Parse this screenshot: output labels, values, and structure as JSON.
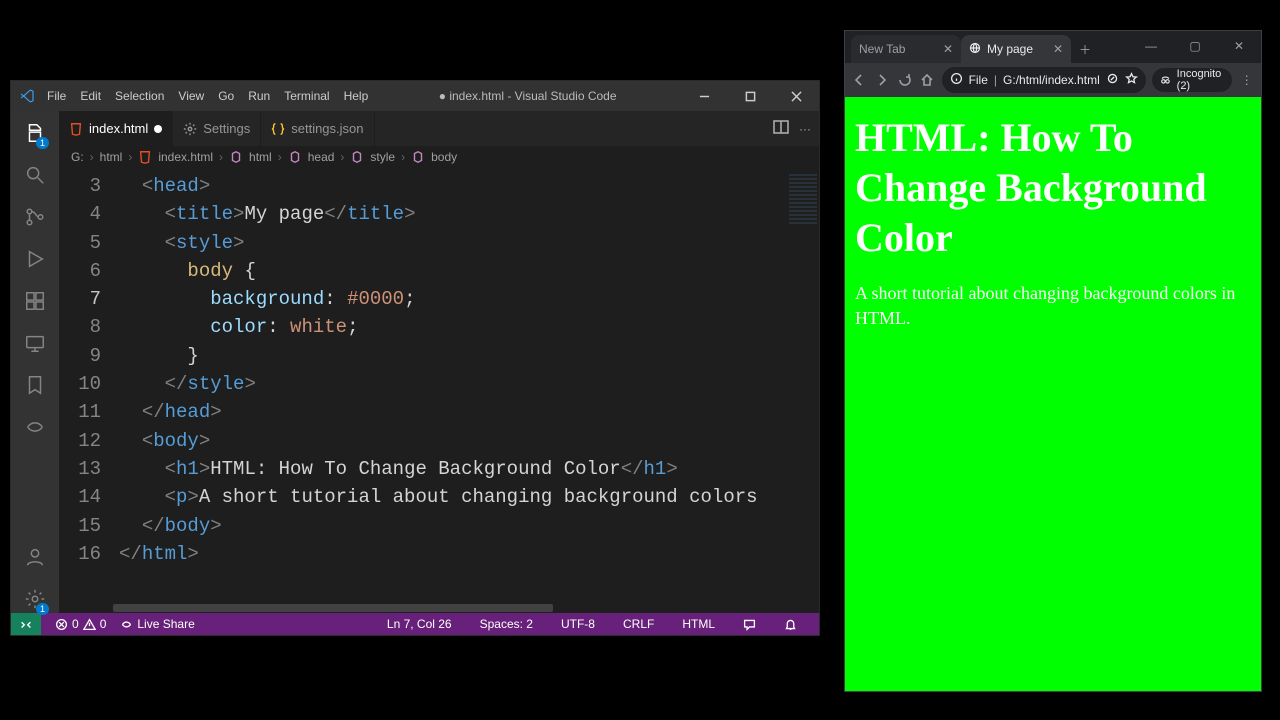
{
  "vscode": {
    "menus": [
      "File",
      "Edit",
      "Selection",
      "View",
      "Go",
      "Run",
      "Terminal",
      "Help"
    ],
    "window_title": "● index.html - Visual Studio Code",
    "tabs": [
      {
        "label": "index.html",
        "dirty": true,
        "active": true,
        "icon": "html"
      },
      {
        "label": "Settings",
        "dirty": false,
        "active": false,
        "icon": "gear"
      },
      {
        "label": "settings.json",
        "dirty": false,
        "active": false,
        "icon": "json"
      }
    ],
    "breadcrumbs": [
      "G:",
      "html",
      "index.html",
      "html",
      "head",
      "style",
      "body"
    ],
    "gutter_start": 3,
    "gutter_end": 16,
    "code_lines": [
      {
        "n": 3,
        "html": "  <span class='tok-tag'>&lt;</span><span class='tok-name'>head</span><span class='tok-tag'>&gt;</span>"
      },
      {
        "n": 4,
        "html": "    <span class='tok-tag'>&lt;</span><span class='tok-name'>title</span><span class='tok-tag'>&gt;</span><span class='tok-text'>My page</span><span class='tok-tag'>&lt;/</span><span class='tok-name'>title</span><span class='tok-tag'>&gt;</span>"
      },
      {
        "n": 5,
        "html": "    <span class='tok-tag'>&lt;</span><span class='tok-name'>style</span><span class='tok-tag'>&gt;</span>"
      },
      {
        "n": 6,
        "html": "      <span class='tok-sel'>body</span> <span class='tok-punc'>{</span>"
      },
      {
        "n": 7,
        "html": "        <span class='tok-prop'>background</span><span class='tok-punc'>:</span> <span class='tok-num'>#0000</span><span class='tok-punc'>;</span>",
        "cursor": true
      },
      {
        "n": 8,
        "html": "        <span class='tok-prop'>color</span><span class='tok-punc'>:</span> <span class='tok-str'>white</span><span class='tok-punc'>;</span>"
      },
      {
        "n": 9,
        "html": "      <span class='tok-punc'>}</span>"
      },
      {
        "n": 10,
        "html": "    <span class='tok-tag'>&lt;/</span><span class='tok-name'>style</span><span class='tok-tag'>&gt;</span>"
      },
      {
        "n": 11,
        "html": "  <span class='tok-tag'>&lt;/</span><span class='tok-name'>head</span><span class='tok-tag'>&gt;</span>"
      },
      {
        "n": 12,
        "html": "  <span class='tok-tag'>&lt;</span><span class='tok-name'>body</span><span class='tok-tag'>&gt;</span>"
      },
      {
        "n": 13,
        "html": "    <span class='tok-tag'>&lt;</span><span class='tok-name'>h1</span><span class='tok-tag'>&gt;</span><span class='tok-text'>HTML: How To Change Background Color</span><span class='tok-tag'>&lt;/</span><span class='tok-name'>h1</span><span class='tok-tag'>&gt;</span>"
      },
      {
        "n": 14,
        "html": "    <span class='tok-tag'>&lt;</span><span class='tok-name'>p</span><span class='tok-tag'>&gt;</span><span class='tok-text'>A short tutorial about changing background colors</span>"
      },
      {
        "n": 15,
        "html": "  <span class='tok-tag'>&lt;/</span><span class='tok-name'>body</span><span class='tok-tag'>&gt;</span>"
      },
      {
        "n": 16,
        "html": "<span class='tok-tag'>&lt;/</span><span class='tok-name'>html</span><span class='tok-tag'>&gt;</span>"
      }
    ],
    "status": {
      "errors": "0",
      "warnings": "0",
      "live_share": "Live Share",
      "line_col": "Ln 7, Col 26",
      "spaces": "Spaces: 2",
      "encoding": "UTF-8",
      "eol": "CRLF",
      "language": "HTML"
    }
  },
  "browser": {
    "tabs": [
      {
        "label": "New Tab",
        "active": false
      },
      {
        "label": "My page",
        "active": true
      }
    ],
    "url_prefix": "File",
    "url": "G:/html/index.html",
    "incognito": "Incognito (2)",
    "page": {
      "heading": "HTML: How To Change Background Color",
      "paragraph": "A short tutorial about changing background colors in HTML.",
      "bg": "#00ff00",
      "fg": "#ffffff"
    }
  }
}
